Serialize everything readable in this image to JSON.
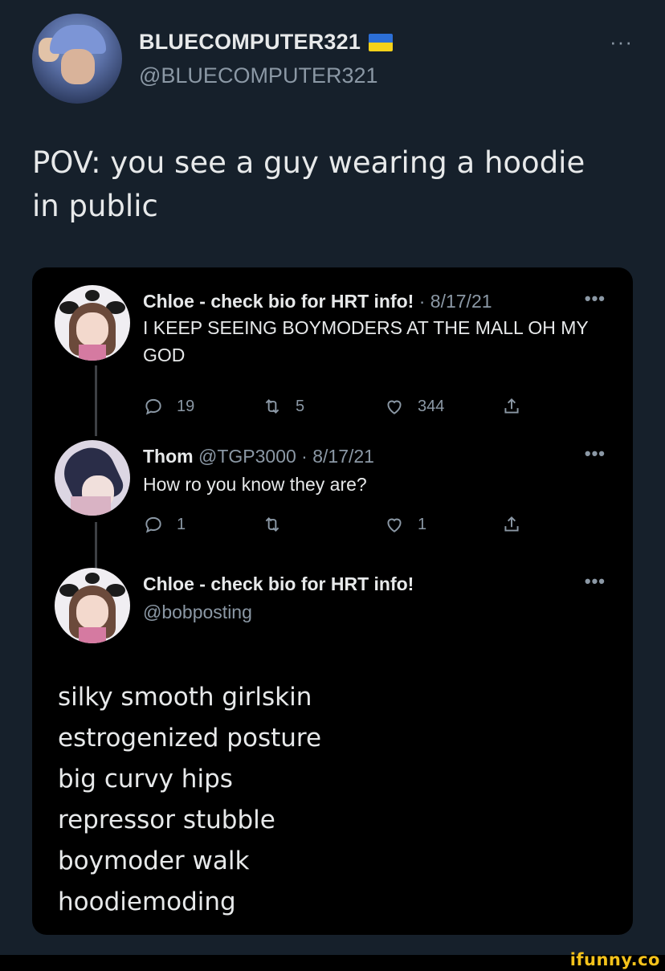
{
  "main_tweet": {
    "display_name": "BLUECOMPUTER321",
    "flag_icon": "ukraine-flag-icon",
    "handle": "@BLUECOMPUTER321",
    "more_label": "···",
    "text_line1": "POV: you see a guy wearing a hoodie",
    "text_line2": "in public"
  },
  "quoted_thread": {
    "reply1": {
      "name": "Chloe - check bio for HRT info!",
      "meta": " · 8/17/21",
      "text": "I KEEP SEEING BOYMODERS AT THE MALL OH MY GOD",
      "more_label": "•••",
      "replies": "19",
      "retweets": "5",
      "likes": "344"
    },
    "reply2": {
      "name": "Thom",
      "handle": " @TGP3000",
      "meta": " · 8/17/21",
      "text": "How ro you know they are?",
      "more_label": "•••",
      "replies": "1",
      "retweets": "",
      "likes": "1"
    },
    "reply3": {
      "name": "Chloe - check bio for HRT info!",
      "handle": "@bobposting",
      "more_label": "•••",
      "lines": [
        "silky smooth girlskin",
        "estrogenized posture",
        "big curvy hips",
        "repressor stubble",
        "boymoder walk",
        "hoodiemoding"
      ]
    }
  },
  "watermark": "ifunny.co",
  "colors": {
    "background": "#16202b",
    "card": "#000000",
    "text": "#e7e9ea",
    "secondary": "#8b98a5",
    "watermark": "#f4c21b"
  }
}
